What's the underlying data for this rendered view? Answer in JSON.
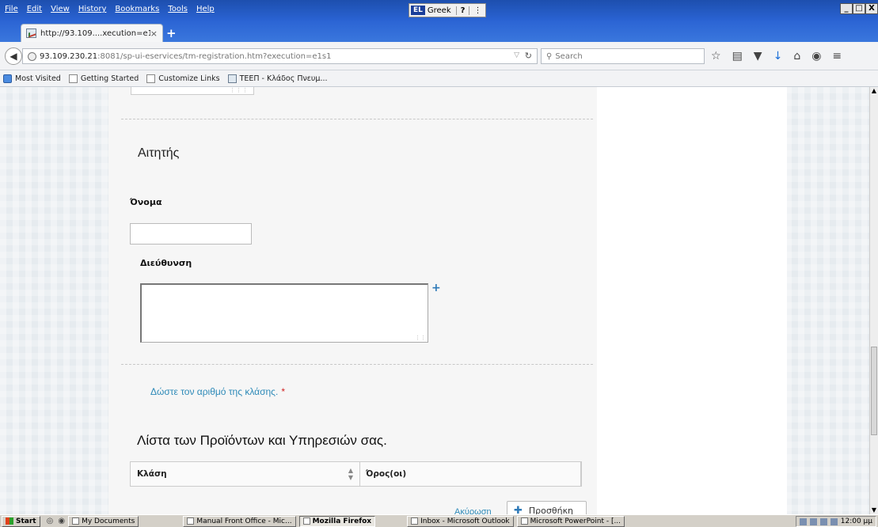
{
  "window": {
    "menus": [
      "File",
      "Edit",
      "View",
      "History",
      "Bookmarks",
      "Tools",
      "Help"
    ],
    "language_code": "EL",
    "language_name": "Greek",
    "help_glyph": "?",
    "controls": [
      "_",
      "□",
      "X"
    ]
  },
  "tabs": [
    {
      "title": "http://93.109....xecution=e1s1",
      "close": "×"
    }
  ],
  "newtab_label": "+",
  "nav": {
    "url_host": "93.109.230.21",
    "url_path": ":8081/sp-ui-eservices/tm-registration.htm?execution=e1s1",
    "search_placeholder": "Search"
  },
  "bookmarks": [
    "Most Visited",
    "Getting Started",
    "Customize Links",
    "ΤΕΕΠ - Κλάδος Πνευμ..."
  ],
  "form": {
    "section_title": "Αιτητής",
    "name_label": "Όνομα",
    "name_value": "",
    "address_label": "Διεύθυνση",
    "address_value": "",
    "add_address_glyph": "+",
    "class_link": "Δώστε τον αριθμό της κλάσης.",
    "required_marker": "*",
    "list_title": "Λίστα των Προϊόντων και Υπηρεσιών σας.",
    "table_headers": [
      "Κλάση",
      "Όρος(οι)"
    ],
    "cancel_label": "Ακύρωση",
    "add_label": "Προσθήκη"
  },
  "taskbar": {
    "start_label": "Start",
    "tasks": [
      {
        "label": "My Documents",
        "active": false
      },
      {
        "label": "Manual Front Office - Mic...",
        "active": false
      },
      {
        "label": "Mozilla Firefox",
        "active": true
      },
      {
        "label": "Inbox - Microsoft Outlook",
        "active": false
      },
      {
        "label": "Microsoft PowerPoint - [...",
        "active": false
      }
    ],
    "clock": "12:00 μμ"
  }
}
